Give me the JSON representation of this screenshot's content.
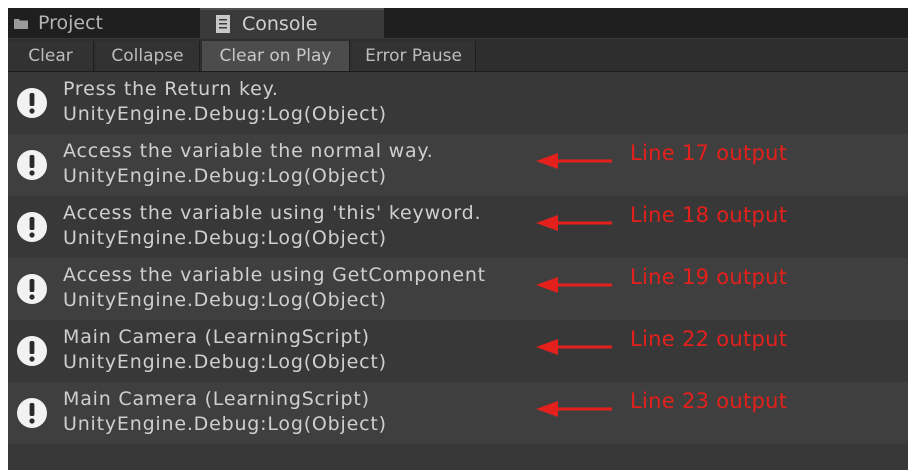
{
  "tabs": [
    {
      "label": "Project",
      "icon": "folder-icon",
      "active": false
    },
    {
      "label": "Console",
      "icon": "console-icon",
      "active": true
    }
  ],
  "toolbar": {
    "buttons": [
      {
        "label": "Clear",
        "active": false
      },
      {
        "label": "Collapse",
        "active": false
      },
      {
        "label": "Clear on Play",
        "active": true
      },
      {
        "label": "Error Pause",
        "active": false
      }
    ]
  },
  "logs": [
    {
      "message": "Press the Return key.",
      "source": "UnityEngine.Debug:Log(Object)",
      "icon": "info-icon",
      "annotation": ""
    },
    {
      "message": "Access the variable the normal way.",
      "source": "UnityEngine.Debug:Log(Object)",
      "icon": "info-icon",
      "annotation": "Line 17 output"
    },
    {
      "message": "Access the variable using 'this' keyword.",
      "source": "UnityEngine.Debug:Log(Object)",
      "icon": "info-icon",
      "annotation": "Line 18 output"
    },
    {
      "message": "Access the variable using GetComponent",
      "source": "UnityEngine.Debug:Log(Object)",
      "icon": "info-icon",
      "annotation": "Line 19 output"
    },
    {
      "message": "Main Camera (LearningScript)",
      "source": "UnityEngine.Debug:Log(Object)",
      "icon": "info-icon",
      "annotation": "Line 22 output"
    },
    {
      "message": "Main Camera (LearningScript)",
      "source": "UnityEngine.Debug:Log(Object)",
      "icon": "info-icon",
      "annotation": "Line 23 output"
    }
  ],
  "colors": {
    "background": "#383838",
    "alt_row": "#3f3f3f",
    "tab_bar": "#1f1f1f",
    "text": "#cfcfcf",
    "annotation": "#e4201c"
  }
}
